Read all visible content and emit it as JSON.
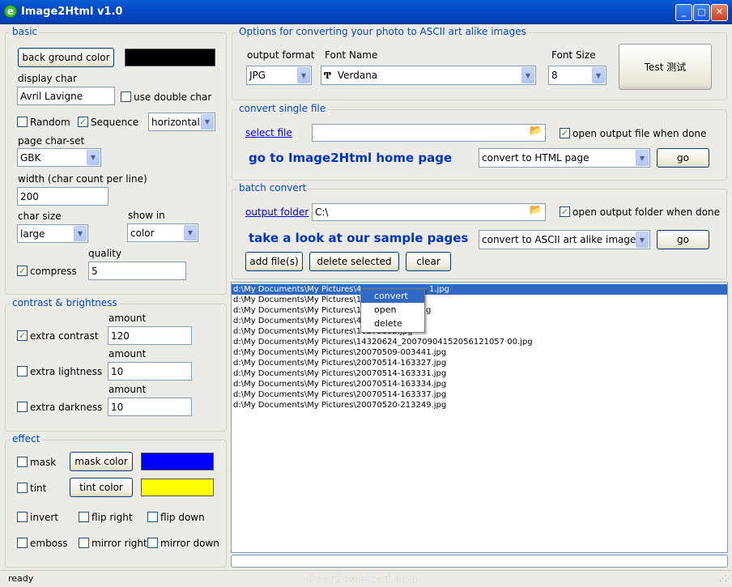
{
  "window": {
    "title": "Image2Html v1.0",
    "app_icon": "e"
  },
  "basic": {
    "title": "basic",
    "bg_button": "back ground color",
    "bg_color": "#000000",
    "display_char_label": "display char",
    "display_char_value": "Avril Lavigne",
    "use_double_char_label": "use double char",
    "use_double_char_checked": false,
    "random_label": "Random",
    "random_checked": false,
    "sequence_label": "Sequence",
    "sequence_checked": true,
    "direction": "horizontal",
    "charset_label": "page char-set",
    "charset": "GBK",
    "width_label": "width (char count per line)",
    "width_value": "200",
    "char_size_label": "char size",
    "char_size": "large",
    "show_in_label": "show in",
    "show_in": "color",
    "quality_label": "quality",
    "compress_label": "compress",
    "compress_checked": true,
    "quality_value": "5"
  },
  "contrast": {
    "title": "contrast & brightness",
    "amount_label": "amount",
    "extra_contrast_label": "extra contrast",
    "extra_contrast_checked": true,
    "extra_contrast_value": "120",
    "extra_lightness_label": "extra lightness",
    "extra_lightness_checked": false,
    "extra_lightness_value": "10",
    "extra_darkness_label": "extra darkness",
    "extra_darkness_checked": false,
    "extra_darkness_value": "10"
  },
  "effect": {
    "title": "effect",
    "mask_label": "mask",
    "mask_button": "mask color",
    "mask_color": "#0000ff",
    "tint_label": "tint",
    "tint_button": "tint color",
    "tint_color": "#ffff00",
    "invert_label": "invert",
    "flip_right_label": "flip right",
    "flip_down_label": "flip down",
    "emboss_label": "emboss",
    "mirror_right_label": "mirror right",
    "mirror_down_label": "mirror down"
  },
  "options": {
    "title": "Options for converting your photo to ASCII art alike images",
    "output_format_label": "output format",
    "output_format": "JPG",
    "font_name_label": "Font Name",
    "font_name": "Verdana",
    "font_size_label": "Font Size",
    "font_size": "8",
    "test_button": "Test 测试"
  },
  "single": {
    "title": "convert single file",
    "select_file": "select file",
    "file_path": "",
    "open_when_done": "open output file when done",
    "open_when_done_checked": true,
    "home_link": "go to Image2Html home page",
    "mode": "convert to HTML page",
    "go": "go"
  },
  "batch": {
    "title": "batch convert",
    "output_folder": "output folder",
    "folder_path": "C:\\",
    "open_folder_when_done": "open output folder when done",
    "open_folder_checked": true,
    "sample_link": "take a look at  our sample pages",
    "mode": "convert to ASCII art alike image",
    "go": "go",
    "add_files": "add file(s)",
    "delete_selected": "delete selected",
    "clear": "clear"
  },
  "files": [
    "d:\\My Documents\\My Pictures\\4",
    "d:\\My Documents\\My Pictures\\10",
    "d:\\My Documents\\My Pictures\\12",
    "d:\\My Documents\\My Pictures\\46",
    "d:\\My Documents\\My Pictures\\10273332.jpg",
    "d:\\My Documents\\My Pictures\\14320624_20070904152056121057 00.jpg",
    "d:\\My Documents\\My Pictures\\20070509-003441.jpg",
    "d:\\My Documents\\My Pictures\\20070514-163327.jpg",
    "d:\\My Documents\\My Pictures\\20070514-163331.jpg",
    "d:\\My Documents\\My Pictures\\20070514-163334.jpg",
    "d:\\My Documents\\My Pictures\\20070514-163337.jpg",
    "d:\\My Documents\\My Pictures\\20070520-213249.jpg"
  ],
  "files_extra": {
    "first_suffix": "1.jpg",
    "row3_suffix": "g"
  },
  "context_menu": [
    "convert",
    "open",
    "delete"
  ],
  "status": "ready",
  "watermark": "GearDownload.com"
}
